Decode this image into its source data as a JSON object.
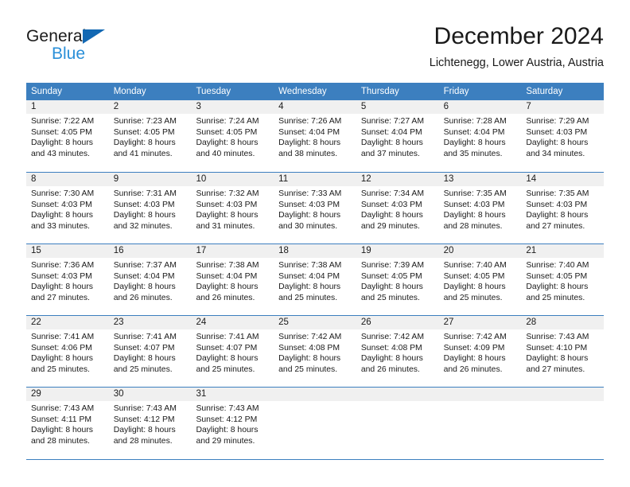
{
  "brand": {
    "name_dark": "General",
    "name_blue": "Blue",
    "accent_color": "#2a8fd8",
    "triangle_color": "#1268b3"
  },
  "header": {
    "title": "December 2024",
    "subtitle": "Lichtenegg, Lower Austria, Austria"
  },
  "calendar": {
    "header_bg": "#3c7fbf",
    "daynum_bg": "#f0f0f0",
    "weekdays": [
      "Sunday",
      "Monday",
      "Tuesday",
      "Wednesday",
      "Thursday",
      "Friday",
      "Saturday"
    ],
    "weeks": [
      [
        {
          "day": "1",
          "sunrise": "Sunrise: 7:22 AM",
          "sunset": "Sunset: 4:05 PM",
          "daylight1": "Daylight: 8 hours",
          "daylight2": "and 43 minutes."
        },
        {
          "day": "2",
          "sunrise": "Sunrise: 7:23 AM",
          "sunset": "Sunset: 4:05 PM",
          "daylight1": "Daylight: 8 hours",
          "daylight2": "and 41 minutes."
        },
        {
          "day": "3",
          "sunrise": "Sunrise: 7:24 AM",
          "sunset": "Sunset: 4:05 PM",
          "daylight1": "Daylight: 8 hours",
          "daylight2": "and 40 minutes."
        },
        {
          "day": "4",
          "sunrise": "Sunrise: 7:26 AM",
          "sunset": "Sunset: 4:04 PM",
          "daylight1": "Daylight: 8 hours",
          "daylight2": "and 38 minutes."
        },
        {
          "day": "5",
          "sunrise": "Sunrise: 7:27 AM",
          "sunset": "Sunset: 4:04 PM",
          "daylight1": "Daylight: 8 hours",
          "daylight2": "and 37 minutes."
        },
        {
          "day": "6",
          "sunrise": "Sunrise: 7:28 AM",
          "sunset": "Sunset: 4:04 PM",
          "daylight1": "Daylight: 8 hours",
          "daylight2": "and 35 minutes."
        },
        {
          "day": "7",
          "sunrise": "Sunrise: 7:29 AM",
          "sunset": "Sunset: 4:03 PM",
          "daylight1": "Daylight: 8 hours",
          "daylight2": "and 34 minutes."
        }
      ],
      [
        {
          "day": "8",
          "sunrise": "Sunrise: 7:30 AM",
          "sunset": "Sunset: 4:03 PM",
          "daylight1": "Daylight: 8 hours",
          "daylight2": "and 33 minutes."
        },
        {
          "day": "9",
          "sunrise": "Sunrise: 7:31 AM",
          "sunset": "Sunset: 4:03 PM",
          "daylight1": "Daylight: 8 hours",
          "daylight2": "and 32 minutes."
        },
        {
          "day": "10",
          "sunrise": "Sunrise: 7:32 AM",
          "sunset": "Sunset: 4:03 PM",
          "daylight1": "Daylight: 8 hours",
          "daylight2": "and 31 minutes."
        },
        {
          "day": "11",
          "sunrise": "Sunrise: 7:33 AM",
          "sunset": "Sunset: 4:03 PM",
          "daylight1": "Daylight: 8 hours",
          "daylight2": "and 30 minutes."
        },
        {
          "day": "12",
          "sunrise": "Sunrise: 7:34 AM",
          "sunset": "Sunset: 4:03 PM",
          "daylight1": "Daylight: 8 hours",
          "daylight2": "and 29 minutes."
        },
        {
          "day": "13",
          "sunrise": "Sunrise: 7:35 AM",
          "sunset": "Sunset: 4:03 PM",
          "daylight1": "Daylight: 8 hours",
          "daylight2": "and 28 minutes."
        },
        {
          "day": "14",
          "sunrise": "Sunrise: 7:35 AM",
          "sunset": "Sunset: 4:03 PM",
          "daylight1": "Daylight: 8 hours",
          "daylight2": "and 27 minutes."
        }
      ],
      [
        {
          "day": "15",
          "sunrise": "Sunrise: 7:36 AM",
          "sunset": "Sunset: 4:03 PM",
          "daylight1": "Daylight: 8 hours",
          "daylight2": "and 27 minutes."
        },
        {
          "day": "16",
          "sunrise": "Sunrise: 7:37 AM",
          "sunset": "Sunset: 4:04 PM",
          "daylight1": "Daylight: 8 hours",
          "daylight2": "and 26 minutes."
        },
        {
          "day": "17",
          "sunrise": "Sunrise: 7:38 AM",
          "sunset": "Sunset: 4:04 PM",
          "daylight1": "Daylight: 8 hours",
          "daylight2": "and 26 minutes."
        },
        {
          "day": "18",
          "sunrise": "Sunrise: 7:38 AM",
          "sunset": "Sunset: 4:04 PM",
          "daylight1": "Daylight: 8 hours",
          "daylight2": "and 25 minutes."
        },
        {
          "day": "19",
          "sunrise": "Sunrise: 7:39 AM",
          "sunset": "Sunset: 4:05 PM",
          "daylight1": "Daylight: 8 hours",
          "daylight2": "and 25 minutes."
        },
        {
          "day": "20",
          "sunrise": "Sunrise: 7:40 AM",
          "sunset": "Sunset: 4:05 PM",
          "daylight1": "Daylight: 8 hours",
          "daylight2": "and 25 minutes."
        },
        {
          "day": "21",
          "sunrise": "Sunrise: 7:40 AM",
          "sunset": "Sunset: 4:05 PM",
          "daylight1": "Daylight: 8 hours",
          "daylight2": "and 25 minutes."
        }
      ],
      [
        {
          "day": "22",
          "sunrise": "Sunrise: 7:41 AM",
          "sunset": "Sunset: 4:06 PM",
          "daylight1": "Daylight: 8 hours",
          "daylight2": "and 25 minutes."
        },
        {
          "day": "23",
          "sunrise": "Sunrise: 7:41 AM",
          "sunset": "Sunset: 4:07 PM",
          "daylight1": "Daylight: 8 hours",
          "daylight2": "and 25 minutes."
        },
        {
          "day": "24",
          "sunrise": "Sunrise: 7:41 AM",
          "sunset": "Sunset: 4:07 PM",
          "daylight1": "Daylight: 8 hours",
          "daylight2": "and 25 minutes."
        },
        {
          "day": "25",
          "sunrise": "Sunrise: 7:42 AM",
          "sunset": "Sunset: 4:08 PM",
          "daylight1": "Daylight: 8 hours",
          "daylight2": "and 25 minutes."
        },
        {
          "day": "26",
          "sunrise": "Sunrise: 7:42 AM",
          "sunset": "Sunset: 4:08 PM",
          "daylight1": "Daylight: 8 hours",
          "daylight2": "and 26 minutes."
        },
        {
          "day": "27",
          "sunrise": "Sunrise: 7:42 AM",
          "sunset": "Sunset: 4:09 PM",
          "daylight1": "Daylight: 8 hours",
          "daylight2": "and 26 minutes."
        },
        {
          "day": "28",
          "sunrise": "Sunrise: 7:43 AM",
          "sunset": "Sunset: 4:10 PM",
          "daylight1": "Daylight: 8 hours",
          "daylight2": "and 27 minutes."
        }
      ],
      [
        {
          "day": "29",
          "sunrise": "Sunrise: 7:43 AM",
          "sunset": "Sunset: 4:11 PM",
          "daylight1": "Daylight: 8 hours",
          "daylight2": "and 28 minutes."
        },
        {
          "day": "30",
          "sunrise": "Sunrise: 7:43 AM",
          "sunset": "Sunset: 4:12 PM",
          "daylight1": "Daylight: 8 hours",
          "daylight2": "and 28 minutes."
        },
        {
          "day": "31",
          "sunrise": "Sunrise: 7:43 AM",
          "sunset": "Sunset: 4:12 PM",
          "daylight1": "Daylight: 8 hours",
          "daylight2": "and 29 minutes."
        },
        {
          "day": "",
          "sunrise": "",
          "sunset": "",
          "daylight1": "",
          "daylight2": ""
        },
        {
          "day": "",
          "sunrise": "",
          "sunset": "",
          "daylight1": "",
          "daylight2": ""
        },
        {
          "day": "",
          "sunrise": "",
          "sunset": "",
          "daylight1": "",
          "daylight2": ""
        },
        {
          "day": "",
          "sunrise": "",
          "sunset": "",
          "daylight1": "",
          "daylight2": ""
        }
      ]
    ]
  }
}
